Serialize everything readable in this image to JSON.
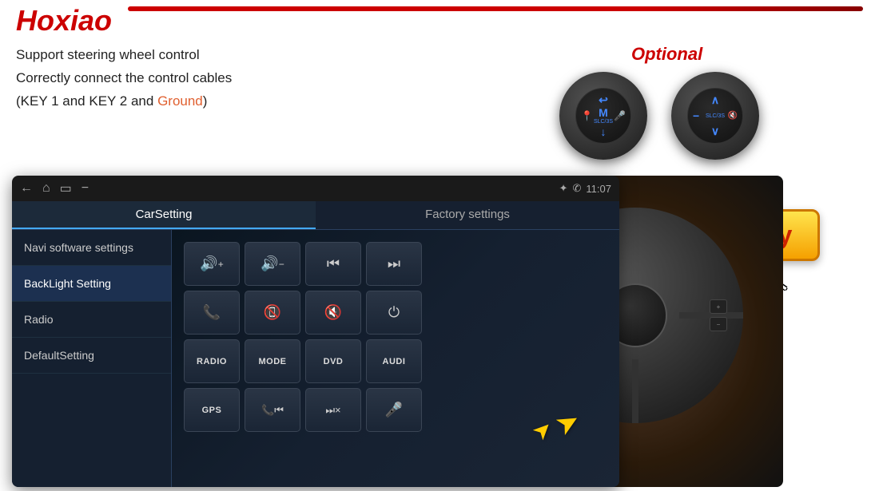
{
  "brand": {
    "name": "Hoxiao"
  },
  "features": {
    "line1": "Support steering wheel control",
    "line2": "Correctly connect the control cables",
    "line3_prefix": "(KEY 1 and KEY 2 and ",
    "line3_ground": "Ground",
    "line3_suffix": ")"
  },
  "optional": {
    "label": "Optional"
  },
  "go_to_buy": {
    "label": "Go to Buy"
  },
  "car_settings": {
    "tab1": "CarSetting",
    "tab2": "Factory settings",
    "status": {
      "pin": "♦",
      "phone": "📞",
      "time": "11:07"
    },
    "menu_items": [
      "Navi software settings",
      "BackLight Setting",
      "Radio",
      "DefaultSetting"
    ],
    "buttons_row1": [
      "🔊+",
      "🔊−",
      "⏮",
      "⏭"
    ],
    "buttons_row2": [
      "📞",
      "📵",
      "🔇",
      "⏻"
    ],
    "buttons_row3": [
      "RADIO",
      "MODE",
      "DVD",
      "AUDI"
    ],
    "buttons_row4": [
      "GPS",
      "📞⏮",
      "⏭×",
      "🎤"
    ]
  },
  "android_header": {
    "back_icon": "←",
    "home_icon": "⌂",
    "recent_icon": "▭",
    "minimize_icon": "−",
    "pin_icon": "✦",
    "phone_icon": "✆",
    "time": "11:07"
  }
}
